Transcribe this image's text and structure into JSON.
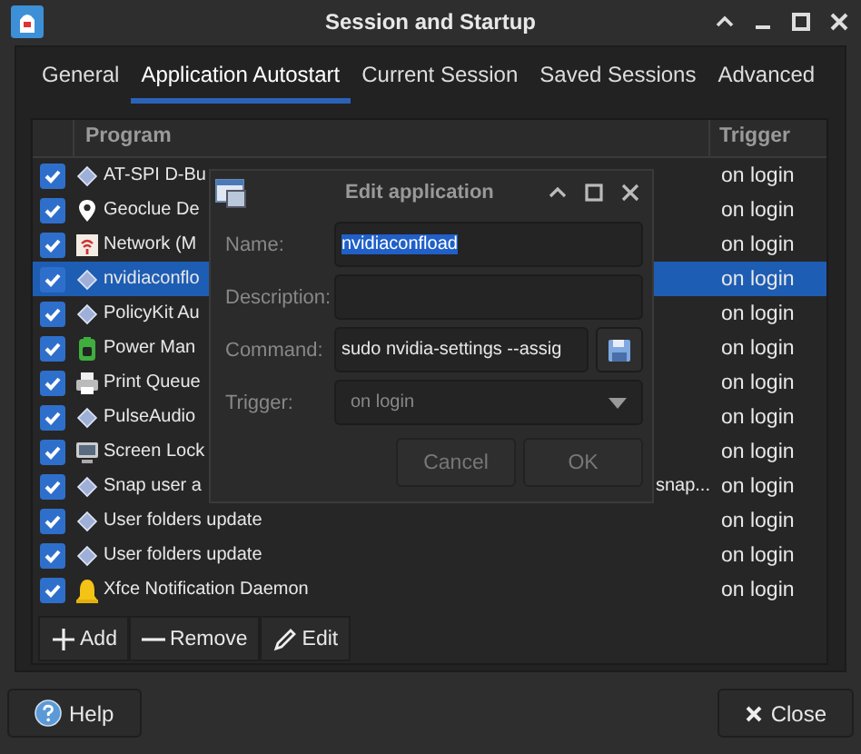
{
  "window": {
    "title": "Session and Startup"
  },
  "tabs": [
    {
      "label": "General",
      "selected": false
    },
    {
      "label": "Application Autostart",
      "selected": true
    },
    {
      "label": "Current Session",
      "selected": false
    },
    {
      "label": "Saved Sessions",
      "selected": false
    },
    {
      "label": "Advanced",
      "selected": false
    }
  ],
  "table": {
    "columns": [
      "Program",
      "Trigger"
    ],
    "rows": [
      {
        "kind": "diamond",
        "program": "AT-SPI D-Bu",
        "trigger": "on login",
        "checked": true,
        "selected": false
      },
      {
        "kind": "pin",
        "program": "Geoclue De",
        "trigger": "on login",
        "checked": true,
        "selected": false
      },
      {
        "kind": "network",
        "program": "Network (M",
        "trigger": "on login",
        "checked": true,
        "selected": false
      },
      {
        "kind": "diamond",
        "program": "nvidiaconflo",
        "trigger": "on login",
        "checked": true,
        "selected": true
      },
      {
        "kind": "diamond",
        "program": "PolicyKit Au",
        "trigger": "on login",
        "checked": true,
        "selected": false
      },
      {
        "kind": "battery",
        "program": "Power Man",
        "trigger": "on login",
        "checked": true,
        "selected": false
      },
      {
        "kind": "printer",
        "program": "Print Queue",
        "trigger": "on login",
        "checked": true,
        "selected": false
      },
      {
        "kind": "diamond",
        "program": "PulseAudio",
        "trigger": "on login",
        "checked": true,
        "selected": false
      },
      {
        "kind": "monitor",
        "program": "Screen Lock",
        "trigger": "on login",
        "checked": true,
        "selected": false
      },
      {
        "kind": "diamond",
        "program": "Snap user a",
        "program_end": "snap...",
        "trigger": "on login",
        "checked": true,
        "selected": false
      },
      {
        "kind": "diamond",
        "program": "User folders update",
        "trigger": "on login",
        "checked": true,
        "selected": false
      },
      {
        "kind": "diamond",
        "program": "User folders update",
        "trigger": "on login",
        "checked": true,
        "selected": false
      },
      {
        "kind": "bell",
        "program": "Xfce Notification Daemon",
        "trigger": "on login",
        "checked": true,
        "selected": false
      }
    ]
  },
  "toolbar": [
    {
      "kind": "add",
      "label": "Add"
    },
    {
      "kind": "remove",
      "label": "Remove"
    },
    {
      "kind": "edit",
      "label": "Edit"
    }
  ],
  "footer": {
    "help": "Help",
    "close": "Close"
  },
  "dialog": {
    "title": "Edit application",
    "fields": [
      {
        "kind": "text",
        "label": "Name:",
        "value": "nvidiaconfload",
        "selected": true
      },
      {
        "kind": "text",
        "label": "Description:"
      },
      {
        "kind": "file",
        "label": "Command:",
        "value": "sudo nvidia-settings --assig"
      },
      {
        "kind": "dropdown",
        "label": "Trigger:",
        "value": "on login"
      }
    ],
    "buttons": [
      "Cancel",
      "OK"
    ]
  }
}
